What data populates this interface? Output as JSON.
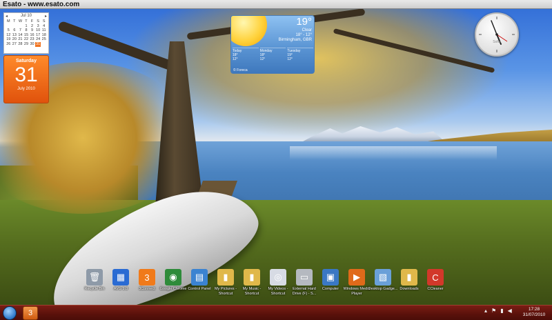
{
  "window": {
    "title": "Esato - www.esato.com"
  },
  "calendar": {
    "month_label": "Jul 10",
    "weekday_headers": [
      "M",
      "T",
      "W",
      "T",
      "F",
      "S",
      "S"
    ],
    "days": [
      "",
      "",
      "",
      "1",
      "2",
      "3",
      "4",
      "5",
      "6",
      "7",
      "8",
      "9",
      "10",
      "11",
      "12",
      "13",
      "14",
      "15",
      "16",
      "17",
      "18",
      "19",
      "20",
      "21",
      "22",
      "23",
      "24",
      "25",
      "26",
      "27",
      "28",
      "29",
      "30",
      "31",
      ""
    ],
    "today": "31",
    "weekday": "Saturday",
    "day_number": "31",
    "month_year": "July 2010"
  },
  "weather": {
    "temperature": "19°",
    "condition": "Clear",
    "range": "18° - 12°",
    "location": "Birmingham, GBR",
    "forecast": [
      {
        "day": "Today",
        "high": "18°",
        "low": "12°"
      },
      {
        "day": "Monday",
        "high": "18°",
        "low": "12°"
      },
      {
        "day": "Tuesday",
        "high": "19°",
        "low": "12°"
      }
    ],
    "provider": "© Foreca"
  },
  "clock_gadget": {
    "label": "Sofia"
  },
  "desktop_icons": [
    {
      "label": "Recycle Bin",
      "icon": "recycle-bin-icon",
      "color": "#8e9aa8"
    },
    {
      "label": "AVG 9.0",
      "icon": "avg-icon",
      "color": "#2a6bd3"
    },
    {
      "label": "3Connect",
      "icon": "three-connect-icon",
      "color": "#f07a1a"
    },
    {
      "label": "Google Chrome",
      "icon": "chrome-icon",
      "color": "#2e8b3a"
    },
    {
      "label": "Control Panel",
      "icon": "control-panel-icon",
      "color": "#3b83d1"
    },
    {
      "label": "My Pictures - Shortcut",
      "icon": "folder-icon",
      "color": "#e0b84a"
    },
    {
      "label": "My Music - Shortcut",
      "icon": "folder-icon",
      "color": "#e0b84a"
    },
    {
      "label": "My Videos - Shortcut",
      "icon": "dvd-icon",
      "color": "#d7dbe4"
    },
    {
      "label": "External Hard Drive (F) - S...",
      "icon": "hard-drive-icon",
      "color": "#b5b9c0"
    },
    {
      "label": "Computer",
      "icon": "computer-icon",
      "color": "#3a78c4"
    },
    {
      "label": "Windows Media Player",
      "icon": "media-player-icon",
      "color": "#e06a1a"
    },
    {
      "label": "Desktop Gadge...",
      "icon": "gadgets-icon",
      "color": "#6aa0d8"
    },
    {
      "label": "Downloads",
      "icon": "folder-icon",
      "color": "#e0b84a"
    },
    {
      "label": "CCleaner",
      "icon": "ccleaner-icon",
      "color": "#d2382a"
    }
  ],
  "taskbar": {
    "start_label": "Start",
    "pinned_label": "3",
    "tray_icons": [
      "arrow-up-icon",
      "flag-icon",
      "network-icon",
      "volume-icon"
    ],
    "time": "17:28",
    "date": "31/07/2010"
  }
}
